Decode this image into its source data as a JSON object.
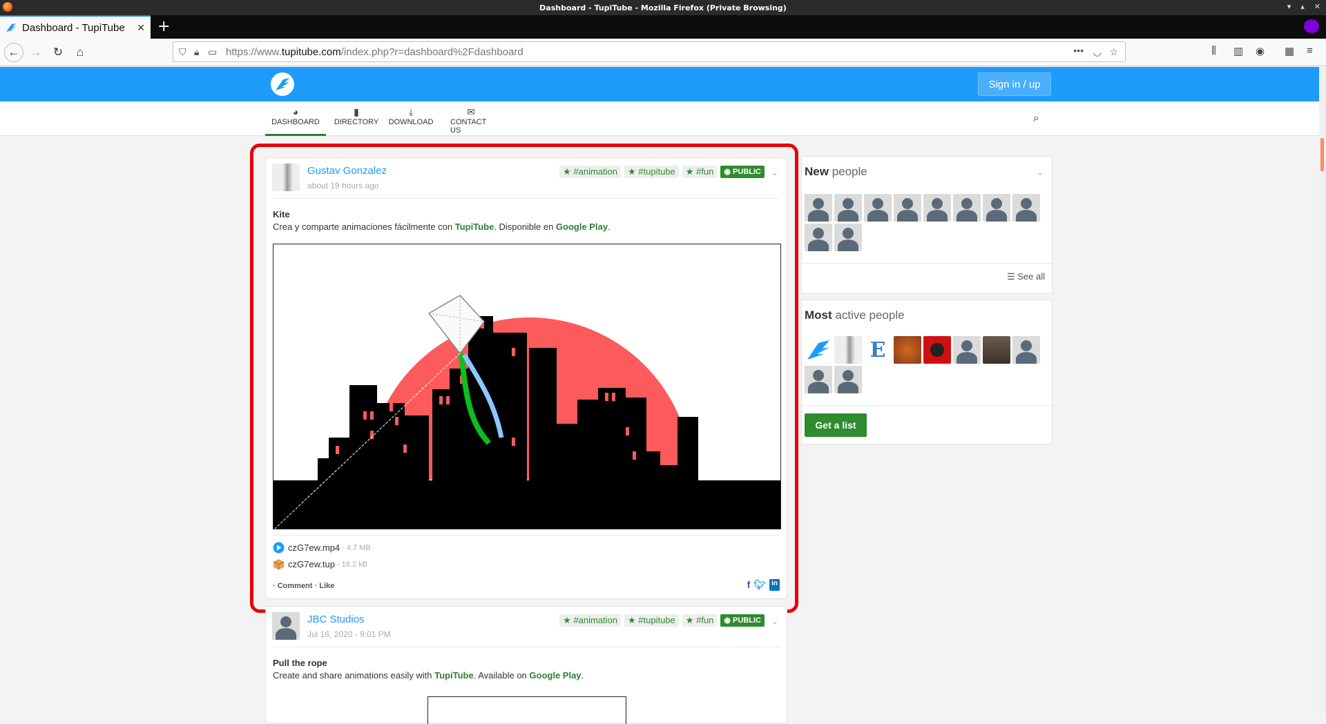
{
  "browser": {
    "window_title": "Dashboard - TupiTube - Mozilla Firefox (Private Browsing)",
    "tab_title": "Dashboard - TupiTube",
    "url_prefix": "https://www.",
    "url_domain": "tupitube.com",
    "url_path": "/index.php?r=dashboard%2Fdashboard",
    "accent_color": "#0a84ff"
  },
  "site": {
    "brand_color": "#1e9bfa",
    "signin_label": "Sign in / up",
    "nav": [
      {
        "label": "DASHBOARD",
        "icon": "dashboard-icon"
      },
      {
        "label": "DIRECTORY",
        "icon": "book-icon"
      },
      {
        "label": "DOWNLOAD",
        "icon": "download-icon"
      },
      {
        "label": "CONTACT US",
        "icon": "envelope-icon"
      }
    ]
  },
  "posts": [
    {
      "author": "Gustav Gonzalez",
      "time": "about 19 hours ago",
      "tags": [
        "#animation",
        "#tupitube",
        "#fun"
      ],
      "visibility": "PUBLIC",
      "title": "Kite",
      "body_pre": "Crea y comparte animaciones fácilmente con ",
      "body_link1": "TupiTube",
      "body_mid": ". Disponible en ",
      "body_link2": "Google Play",
      "body_post": ".",
      "files": [
        {
          "name": "czG7ew.mp4",
          "size": "- 4.7 MB",
          "icon": "play-icon"
        },
        {
          "name": "czG7ew.tup",
          "size": "- 18.2 kB",
          "icon": "package-icon"
        }
      ],
      "actions": "· Comment · Like"
    },
    {
      "author": "JBC Studios",
      "time": "Jul 16, 2020 - 9:01 PM",
      "tags": [
        "#animation",
        "#tupitube",
        "#fun"
      ],
      "visibility": "PUBLIC",
      "title": "Pull the rope",
      "body_pre": "Create and share animations easily with ",
      "body_link1": "TupiTube",
      "body_mid": ". Available on ",
      "body_link2": "Google Play",
      "body_post": "."
    }
  ],
  "sidebar": {
    "new_people_bold": "New",
    "new_people_rest": " people",
    "see_all": "See all",
    "active_bold": "Most",
    "active_rest": " active people",
    "get_list": "Get a list"
  }
}
